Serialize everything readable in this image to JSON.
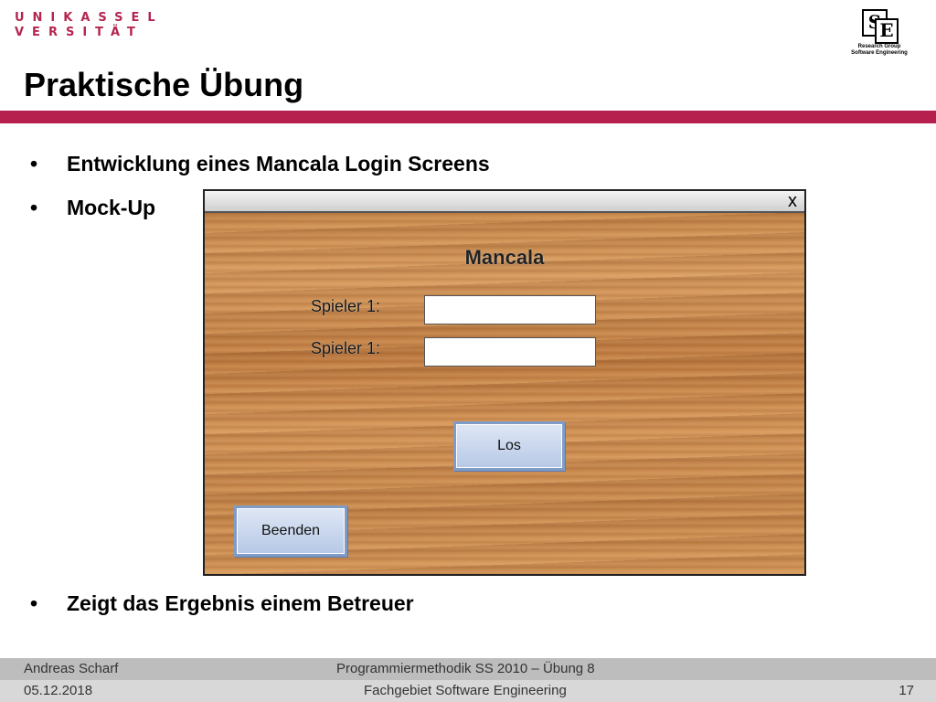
{
  "logo": {
    "university_line1": "UNIKASSEL",
    "university_line2": "VERSITÄT",
    "group_s": "S",
    "group_e": "E",
    "group_line1": "Research Group",
    "group_line2": "Software Engineering"
  },
  "slide": {
    "title": "Praktische Übung",
    "bullets": [
      "Entwicklung eines Mancala Login Screens",
      "Mock-Up",
      "Zeigt das Ergebnis einem Betreuer"
    ],
    "bullet_char": "•"
  },
  "mockup": {
    "close_label": "x",
    "title": "Mancala",
    "player1_label": "Spieler 1:",
    "player2_label": "Spieler 1:",
    "player1_value": "",
    "player2_value": "",
    "start_button": "Los",
    "quit_button": "Beenden"
  },
  "footer": {
    "author": "Andreas Scharf",
    "course": "Programmiermethodik SS 2010 – Übung 8",
    "date": "05.12.2018",
    "department": "Fachgebiet Software Engineering",
    "page": "17"
  },
  "colors": {
    "accent": "#b5204f",
    "wood": "#c98a4d",
    "button": "#b6c8e6"
  }
}
